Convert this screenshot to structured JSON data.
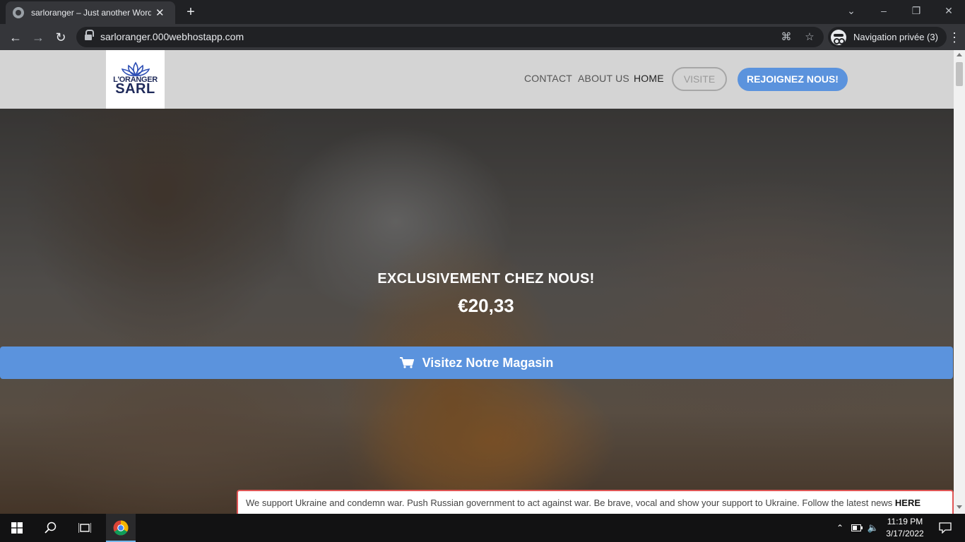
{
  "browser": {
    "tab_title": "sarloranger – Just another WordPress site",
    "url": "sarloranger.000webhostapp.com",
    "incognito_label": "Navigation privée (3)"
  },
  "site": {
    "logo_line1": "L'ORANGER",
    "logo_line2": "SARL",
    "nav": {
      "contact": "CONTACT",
      "about": "ABOUT US",
      "home": "HOME",
      "visite": "VISITE",
      "join": "REJOIGNEZ NOUS!"
    },
    "hero": {
      "kicker": "EXCLUSIVEMENT CHEZ NOUS!",
      "price": "€20,33",
      "shop_button": "Visitez Notre Magasin"
    },
    "notice": {
      "text": "We support Ukraine and condemn war. Push Russian government to act against war. Be brave, vocal and show your support to Ukraine. Follow the latest news ",
      "link": "HERE"
    }
  },
  "taskbar": {
    "time": "11:19 PM",
    "date": "3/17/2022"
  },
  "colors": {
    "accent": "#5b93dd",
    "header_bg": "#d4d4d4",
    "notice_border": "#e05555"
  }
}
